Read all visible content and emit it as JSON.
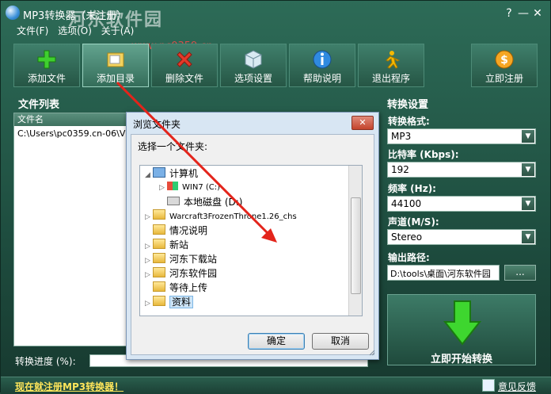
{
  "window": {
    "title": "MP3转换器（未注册）",
    "help": "?",
    "minimize": "—",
    "close": "✕"
  },
  "watermark": {
    "text": "河东软件园",
    "url": "www.pc0359.cn"
  },
  "menu": [
    "文件(F)",
    "选项(O)",
    "关于(A)"
  ],
  "toolbar": [
    {
      "label": "添加文件",
      "icon": "plus-icon"
    },
    {
      "label": "添加目录",
      "icon": "folder-icon"
    },
    {
      "label": "删除文件",
      "icon": "delete-icon"
    },
    {
      "label": "选项设置",
      "icon": "cube-icon"
    },
    {
      "label": "帮助说明",
      "icon": "info-icon"
    },
    {
      "label": "退出程序",
      "icon": "run-icon"
    },
    {
      "label": "立即注册",
      "icon": "dollar-icon"
    }
  ],
  "file_list": {
    "title": "文件列表",
    "column": "文件名",
    "rows": [
      "C:\\Users\\pc0359.cn-06\\V"
    ]
  },
  "progress": {
    "label": "转换进度 (%):",
    "value": 0
  },
  "status": {
    "register_link": "现在就注册MP3转换器！",
    "feedback": "意见反馈"
  },
  "settings": {
    "title": "转换设置",
    "format_label": "转换格式:",
    "format": "MP3",
    "bitrate_label": "比特率 (Kbps):",
    "bitrate": "192",
    "samplerate_label": "频率 (Hz):",
    "samplerate": "44100",
    "channel_label": "声道(M/S):",
    "channel": "Stereo",
    "output_label": "输出路径:",
    "output_path": "D:\\tools\\桌面\\河东软件园",
    "browse": "...",
    "start": "立即开始转换"
  },
  "dialog": {
    "title": "浏览文件夹",
    "close": "✕",
    "prompt": "选择一个文件夹:",
    "tree": [
      {
        "label": "计算机",
        "expander": "◢",
        "icon": "computer-icon"
      },
      {
        "label": "WIN7 (C:)",
        "expander": "▷",
        "icon": "win7-drive-icon"
      },
      {
        "label": "本地磁盘 (D:)",
        "expander": "",
        "icon": "drive-icon"
      },
      {
        "label": "Warcraft3FrozenThrone1.26_chs",
        "expander": "▷",
        "icon": "folder-icon"
      },
      {
        "label": "情况说明",
        "expander": "",
        "icon": "folder-icon"
      },
      {
        "label": "新站",
        "expander": "▷",
        "icon": "folder-icon"
      },
      {
        "label": "河东下载站",
        "expander": "▷",
        "icon": "folder-icon"
      },
      {
        "label": "河东软件园",
        "expander": "▷",
        "icon": "folder-icon"
      },
      {
        "label": "等待上传",
        "expander": "",
        "icon": "folder-icon"
      },
      {
        "label": "资料",
        "expander": "▷",
        "icon": "folder-icon",
        "selected": true
      }
    ],
    "ok": "确定",
    "cancel": "取消"
  }
}
